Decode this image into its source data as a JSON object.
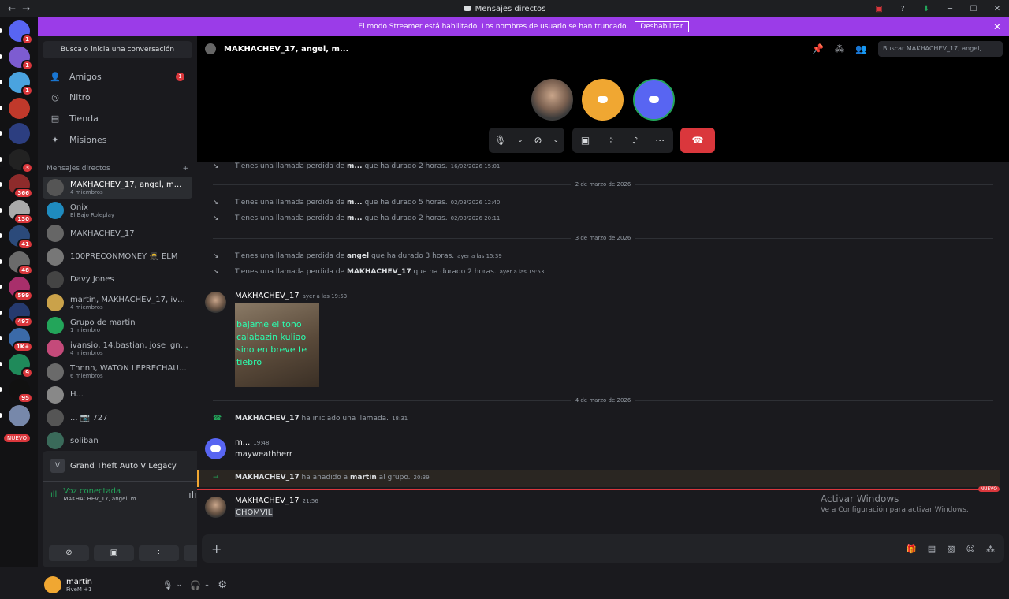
{
  "titlebar": {
    "title": "Mensajes directos"
  },
  "banner": {
    "text": "El modo Streamer está habilitado. Los nombres de usuario se han truncado.",
    "button": "Deshabilitar"
  },
  "servers": [
    {
      "badge": "1",
      "color": "#5865f2"
    },
    {
      "badge": "1",
      "color": "#7d5cd1"
    },
    {
      "badge": "1",
      "color": "#4aa3df"
    },
    {
      "badge": "",
      "color": "#c0392b"
    },
    {
      "badge": "",
      "color": "#2c3e80"
    },
    {
      "badge": "3",
      "color": "#222"
    },
    {
      "badge": "366",
      "color": "#8e2b2b"
    },
    {
      "badge": "130",
      "color": "#aaa"
    },
    {
      "badge": "41",
      "color": "#2b4a7a"
    },
    {
      "badge": "48",
      "color": "#6b6b6b"
    },
    {
      "badge": "599",
      "color": "#a82f6b"
    },
    {
      "badge": "497",
      "color": "#253a6e"
    },
    {
      "badge": "1K+",
      "color": "#3b6aa8"
    },
    {
      "badge": "9",
      "color": "#1f8a5a"
    },
    {
      "badge": "95",
      "color": "#111"
    },
    {
      "badge": "",
      "color": "#7788aa"
    }
  ],
  "servers_new": "NUEVO",
  "dm_sidebar": {
    "search": "Busca o inicia una conversación",
    "nav": [
      {
        "label": "Amigos",
        "badge": "1"
      },
      {
        "label": "Nitro",
        "badge": ""
      },
      {
        "label": "Tienda",
        "badge": ""
      },
      {
        "label": "Misiones",
        "badge": ""
      }
    ],
    "dm_header": "Mensajes directos",
    "dms": [
      {
        "name": "MAKHACHEV_17, angel, m...",
        "sub": "4 miembros",
        "color": "#555"
      },
      {
        "name": "Onix",
        "sub": "El Bajo Roleplay",
        "color": "#1f8bbf"
      },
      {
        "name": "MAKHACHEV_17",
        "sub": "",
        "color": "#666"
      },
      {
        "name": "100PRECONMONEY 🥷 ELM",
        "sub": "",
        "color": "#777"
      },
      {
        "name": "Davy Jones",
        "sub": "",
        "color": "#444"
      },
      {
        "name": "martin, MAKHACHEV_17, ivansio",
        "sub": "4 miembros",
        "color": "#caa24a"
      },
      {
        "name": "Grupo de martin",
        "sub": "1 miembro",
        "color": "#23a55a"
      },
      {
        "name": "ivansio, 14.bastian, jose ignacio",
        "sub": "4 miembros",
        "color": "#c44a7a"
      },
      {
        "name": "Tnnnn, WATON LEPRECHAUN...",
        "sub": "6 miembros",
        "color": "#6a6a6a"
      },
      {
        "name": "H...",
        "sub": "",
        "color": "#888"
      },
      {
        "name": "... 📷 727",
        "sub": "",
        "color": "#555"
      },
      {
        "name": "soliban",
        "sub": "",
        "color": "#3a6a5a"
      }
    ]
  },
  "activity": {
    "game": "Grand Theft Auto V Legacy"
  },
  "voice": {
    "status": "Voz conectada",
    "channel": "MAKHACHEV_17, angel, m..."
  },
  "user": {
    "name": "martin",
    "status": "FiveM +1"
  },
  "header": {
    "title": "MAKHACHEV_17, angel, m...",
    "search_placeholder": "Buscar MAKHACHEV_17, angel, ..."
  },
  "messages": {
    "sys1": {
      "pre": "Tienes una llamada perdida de",
      "who": "m...",
      "post": "que ha durado 2 horas.",
      "ts": "16/02/2026 15:01"
    },
    "div1": "2 de marzo de 2026",
    "sys2": {
      "pre": "Tienes una llamada perdida de",
      "who": "m...",
      "post": "que ha durado 5 horas.",
      "ts": "02/03/2026 12:40"
    },
    "sys3": {
      "pre": "Tienes una llamada perdida de",
      "who": "m...",
      "post": "que ha durado 2 horas.",
      "ts": "02/03/2026 20:11"
    },
    "div2": "3 de marzo de 2026",
    "sys4": {
      "pre": "Tienes una llamada perdida de",
      "who": "angel",
      "post": "que ha durado 3 horas.",
      "ts": "ayer a las 15:39"
    },
    "sys5": {
      "pre": "Tienes una llamada perdida de",
      "who": "MAKHACHEV_17",
      "post": "que ha durado 2 horas.",
      "ts": "ayer a las 19:53"
    },
    "msg1": {
      "author": "MAKHACHEV_17",
      "ts": "ayer a las 19:53",
      "image_text": "bajame el tono calabazin kuliao sino en breve te tiebro"
    },
    "div3": "4 de marzo de 2026",
    "sys6": {
      "who": "MAKHACHEV_17",
      "post": "ha iniciado una llamada.",
      "ts": "18:31"
    },
    "msg2": {
      "author": "m...",
      "ts": "19:48",
      "text": "mayweathherr"
    },
    "sys7": {
      "who": "MAKHACHEV_17",
      "mid": "ha añadido a",
      "target": "martin",
      "post": "al grupo.",
      "ts": "20:39"
    },
    "new_badge": "NUEVO",
    "msg3": {
      "author": "MAKHACHEV_17",
      "ts": "21:56",
      "text": "CHOMVIL"
    }
  },
  "watermark": {
    "line1": "Activar Windows",
    "line2": "Ve a Configuración para activar Windows."
  }
}
